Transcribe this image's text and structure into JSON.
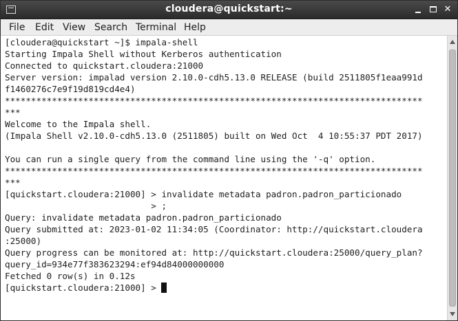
{
  "window": {
    "title": "cloudera@quickstart:~"
  },
  "menu": {
    "items": [
      "File",
      "Edit",
      "View",
      "Search",
      "Terminal",
      "Help"
    ]
  },
  "terminal": {
    "lines": [
      "[cloudera@quickstart ~]$ impala-shell",
      "Starting Impala Shell without Kerberos authentication",
      "Connected to quickstart.cloudera:21000",
      "Server version: impalad version 2.10.0-cdh5.13.0 RELEASE (build 2511805f1eaa991d",
      "f1460276c7e9f19d819cd4e4)",
      "********************************************************************************",
      "***",
      "Welcome to the Impala shell.",
      "(Impala Shell v2.10.0-cdh5.13.0 (2511805) built on Wed Oct  4 10:55:37 PDT 2017)",
      "",
      "You can run a single query from the command line using the '-q' option.",
      "********************************************************************************",
      "***",
      "[quickstart.cloudera:21000] > invalidate metadata padron.padron_particionado",
      "                            > ;",
      "Query: invalidate metadata padron.padron_particionado",
      "Query submitted at: 2023-01-02 11:34:05 (Coordinator: http://quickstart.cloudera",
      ":25000)",
      "Query progress can be monitored at: http://quickstart.cloudera:25000/query_plan?",
      "query_id=934e77f383623294:ef94d84000000000",
      "Fetched 0 row(s) in 0.12s"
    ],
    "prompt": "[quickstart.cloudera:21000] > "
  }
}
